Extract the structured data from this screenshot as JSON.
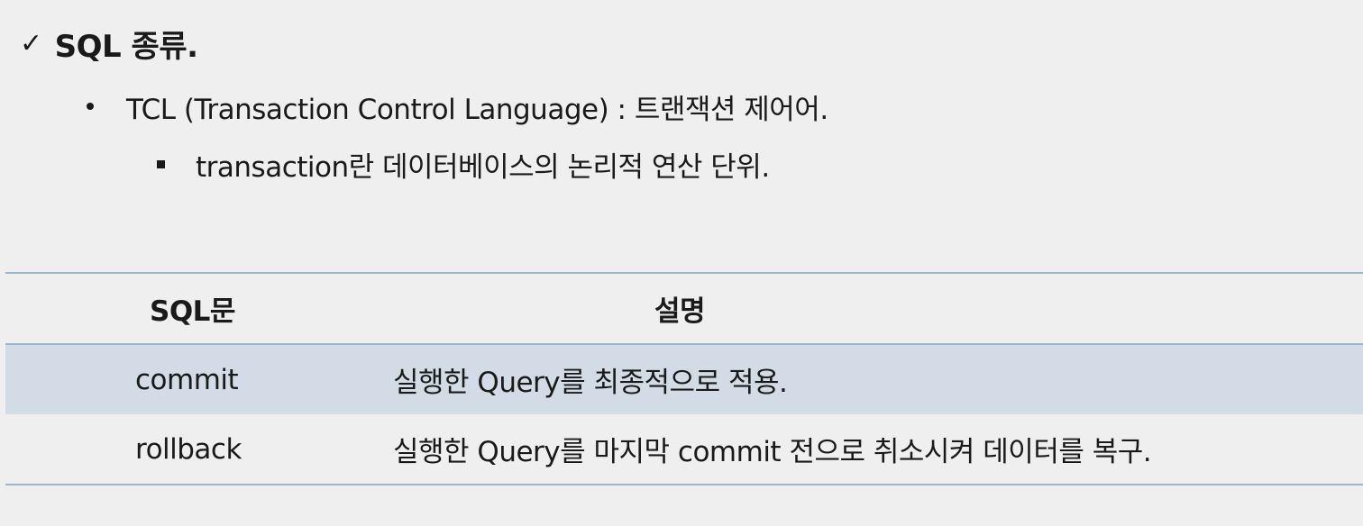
{
  "heading": {
    "check": "✓",
    "text": "SQL 종류."
  },
  "bullets": [
    {
      "level": 1,
      "text": "TCL (Transaction Control Language) : 트랜잭션 제어어."
    },
    {
      "level": 2,
      "text": "transaction란 데이터베이스의 논리적 연산 단위."
    }
  ],
  "table": {
    "headers": [
      "SQL문",
      "설명"
    ],
    "rows": [
      [
        "commit",
        "실행한 Query를 최종적으로 적용."
      ],
      [
        "rollback",
        "실행한 Query를 마지막 commit 전으로 취소시켜 데이터를 복구."
      ]
    ]
  },
  "colors": {
    "background": "#efefef",
    "row_shade": "#d3dce6",
    "rule": "#9db7cf",
    "text": "#1a1a1a"
  }
}
